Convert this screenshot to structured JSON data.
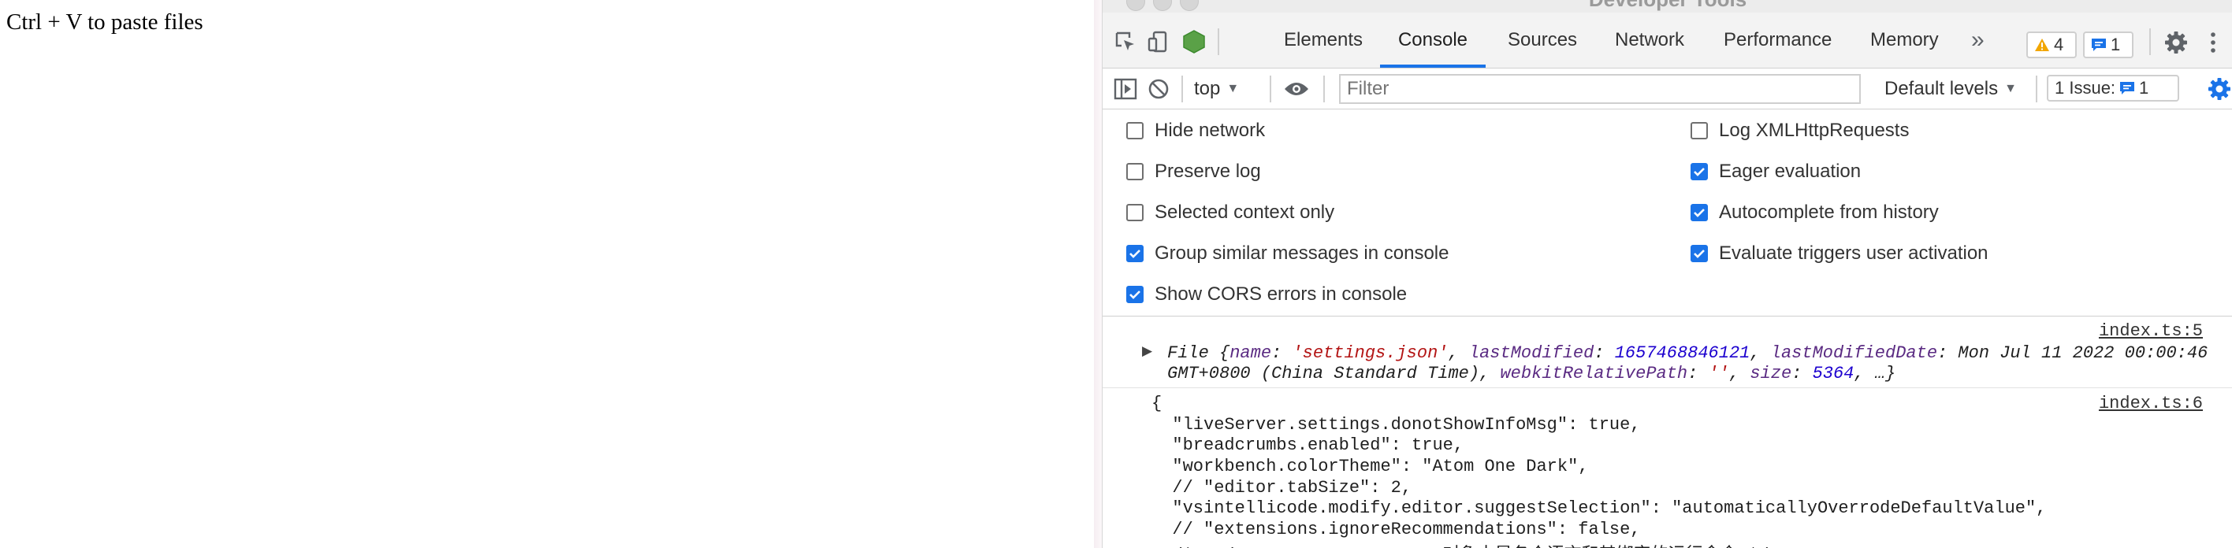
{
  "page": {
    "text": "Ctrl + V to paste files"
  },
  "devtools": {
    "title": "Developer Tools",
    "tabs": [
      {
        "label": "Elements"
      },
      {
        "label": "Console"
      },
      {
        "label": "Sources"
      },
      {
        "label": "Network"
      },
      {
        "label": "Performance"
      },
      {
        "label": "Memory"
      }
    ],
    "more_tabs_glyph": "»",
    "warning_count": "4",
    "message_count": "1",
    "context": "top",
    "filter_placeholder": "Filter",
    "default_levels": "Default levels",
    "issues_label": "1 Issue:",
    "issues_count": "1",
    "settings": {
      "hide_network": {
        "label": "Hide network",
        "checked": false
      },
      "log_xhr": {
        "label": "Log XMLHttpRequests",
        "checked": false
      },
      "preserve_log": {
        "label": "Preserve log",
        "checked": false
      },
      "eager_eval": {
        "label": "Eager evaluation",
        "checked": true
      },
      "selected_context": {
        "label": "Selected context only",
        "checked": false
      },
      "autocomplete": {
        "label": "Autocomplete from history",
        "checked": true
      },
      "group_similar": {
        "label": "Group similar messages in console",
        "checked": true
      },
      "eval_triggers": {
        "label": "Evaluate triggers user activation",
        "checked": true
      },
      "cors_errors": {
        "label": "Show CORS errors in console",
        "checked": true
      }
    },
    "messages": [
      {
        "source": "index.ts:5",
        "prefix": "File {",
        "name_key": "name",
        "name_val": "'settings.json'",
        "lm_key": "lastModified",
        "lm_val": "1657468846121",
        "lmd_key": "lastModifiedDate",
        "lmd_val": "Mon Jul 11 2022 00:00:46",
        "lmd_val2": "GMT+0800 (China Standard Time)",
        "wrp_key": "webkitRelativePath",
        "wrp_val": "''",
        "size_key": "size",
        "size_val": "5364",
        "suffix": ", …}"
      },
      {
        "source": "index.ts:6",
        "lines": [
          "{",
          "  \"liveServer.settings.donotShowInfoMsg\": true,",
          "  \"breadcrumbs.enabled\": true,",
          "  \"workbench.colorTheme\": \"Atom One Dark\",",
          "  // \"editor.tabSize\": 2,",
          "  \"vsintellicode.modify.editor.suggestSelection\": \"automaticallyOverrodeDefaultValue\",",
          "  // \"extensions.ignoreRecommendations\": false,",
          "  /* code-runner.executorMap对象中是各个语言和其绑定的运行命令 */"
        ]
      }
    ]
  }
}
